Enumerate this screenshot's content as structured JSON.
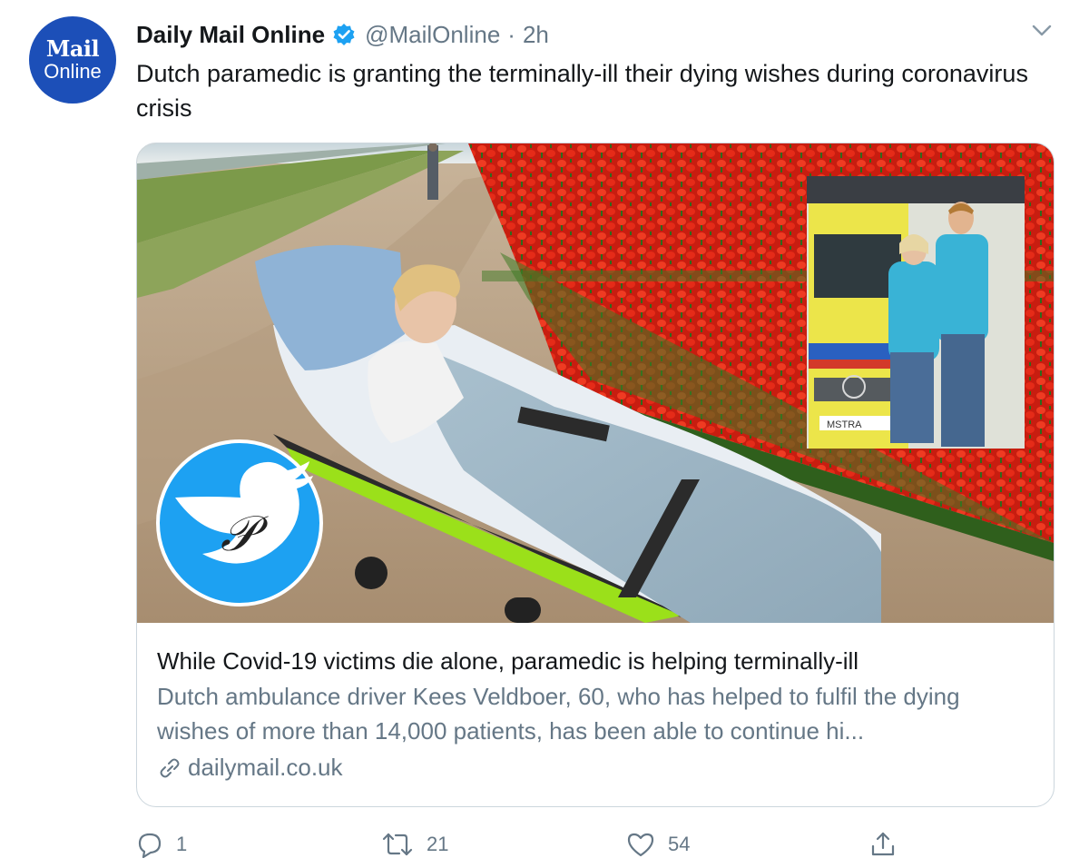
{
  "tweet": {
    "avatar": {
      "line1": "Mail",
      "line2": "Online"
    },
    "author_name": "Daily Mail Online",
    "handle": "@MailOnline",
    "separator": "·",
    "time": "2h",
    "text": "Dutch paramedic is granting the terminally-ill their dying wishes during coronavirus crisis",
    "icons": {
      "verified": "verified-badge-icon",
      "caret": "chevron-down-icon",
      "link": "link-icon",
      "reply": "reply-icon",
      "retweet": "retweet-icon",
      "like": "heart-icon",
      "share": "share-icon",
      "watermark": "twitter-bird-icon"
    }
  },
  "card": {
    "title": "While Covid-19 victims die alone, paramedic is helping terminally-ill",
    "description": "Dutch ambulance driver Kees Veldboer, 60, who has helped to fulfil the dying wishes of more than 14,000 patients, has been able to continue hi...",
    "domain": "dailymail.co.uk",
    "inset_plate_text": "MSTRA"
  },
  "actions": {
    "reply_count": "1",
    "retweet_count": "21",
    "like_count": "54"
  },
  "colors": {
    "brand_blue": "#1da1f2",
    "avatar_blue": "#1c4fb8",
    "secondary_text": "#657786",
    "border": "#ccd6dd"
  }
}
